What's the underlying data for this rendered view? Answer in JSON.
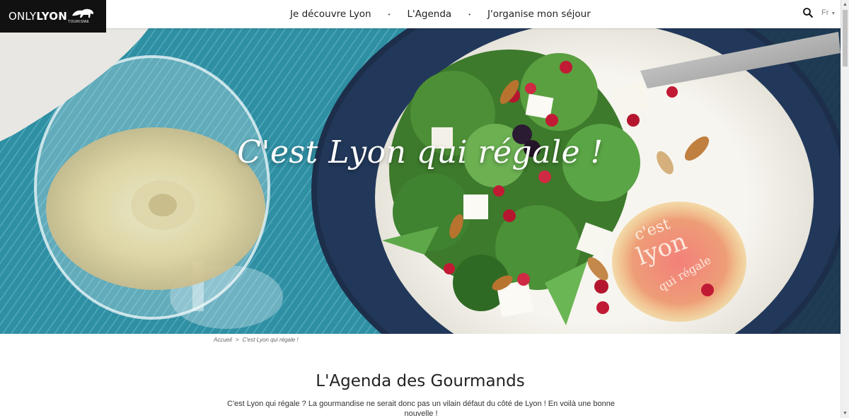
{
  "brand": {
    "name_light": "ONLY",
    "name_bold": "LYON",
    "subtitle": "TOURISME"
  },
  "nav": {
    "items": [
      "Je découvre Lyon",
      "L'Agenda",
      "J'organise mon séjour"
    ],
    "separator": "•"
  },
  "header_tools": {
    "search_icon": "search-icon",
    "language": "Fr"
  },
  "hero": {
    "title": "C'est Lyon qui régale !",
    "stamp_lines": [
      "c'est",
      "lyon",
      "qui régale"
    ]
  },
  "breadcrumb": {
    "home": "Accueil",
    "separator": ">",
    "current": "C'est Lyon qui régale !"
  },
  "section": {
    "title": "L'Agenda des Gourmands",
    "intro": "C'est Lyon qui régale ? La gourmandise ne serait donc pas un vilain défaut du côté de Lyon ! En voilà une bonne nouvelle !"
  },
  "colors": {
    "header_bg": "#ffffff",
    "logo_bg": "#111111",
    "tablecloth": "#2f8fa3",
    "plate_rim": "#1c2e4a"
  }
}
